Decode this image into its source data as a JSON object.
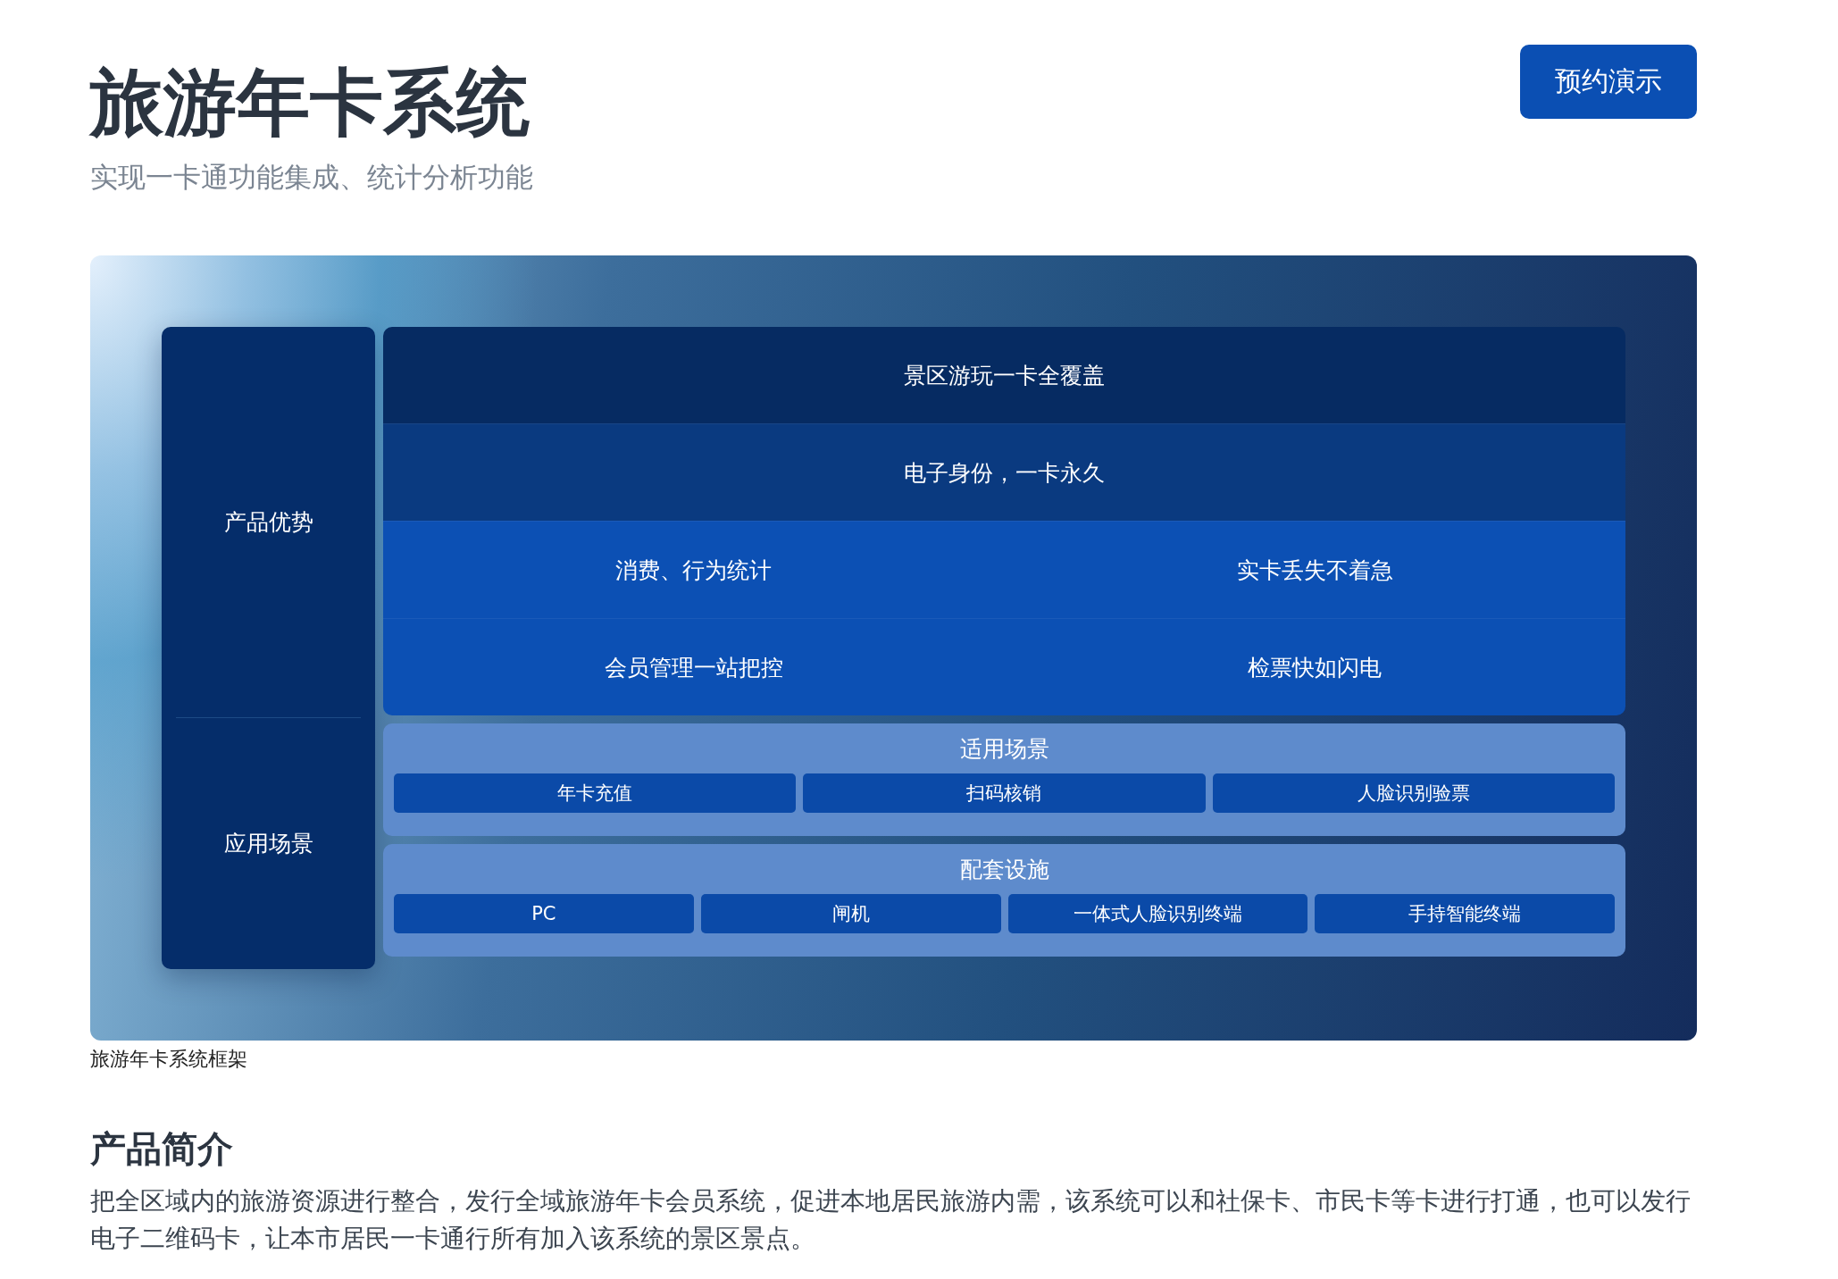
{
  "header": {
    "title": "旅游年卡系统",
    "subtitle": "实现一卡通功能集成、统计分析功能",
    "demo_button": "预约演示"
  },
  "diagram": {
    "side_labels": [
      "产品优势",
      "应用场景"
    ],
    "advantage_rows": [
      {
        "kind": "dark",
        "cells": [
          "景区游玩一卡全覆盖"
        ]
      },
      {
        "kind": "medium",
        "cells": [
          "电子身份，一卡永久"
        ]
      },
      {
        "kind": "bright",
        "cells": [
          "消费、行为统计",
          "实卡丢失不着急"
        ]
      },
      {
        "kind": "bright",
        "cells": [
          "会员管理一站把控",
          "检票快如闪电"
        ]
      }
    ],
    "panels": [
      {
        "title": "适用场景",
        "items": [
          "年卡充值",
          "扫码核销",
          "人脸识别验票"
        ]
      },
      {
        "title": "配套设施",
        "items": [
          "PC",
          "闸机",
          "一体式人脸识别终端",
          "手持智能终端"
        ]
      }
    ],
    "caption": "旅游年卡系统框架"
  },
  "intro": {
    "heading": "产品简介",
    "paragraph": "把全区域内的旅游资源进行整合，发行全域旅游年卡会员系统，促进本地居民旅游内需，该系统可以和社保卡、市民卡等卡进行打通，也可以发行电子二维码卡，让本市居民一卡通行所有加入该系统的景区景点。"
  }
}
